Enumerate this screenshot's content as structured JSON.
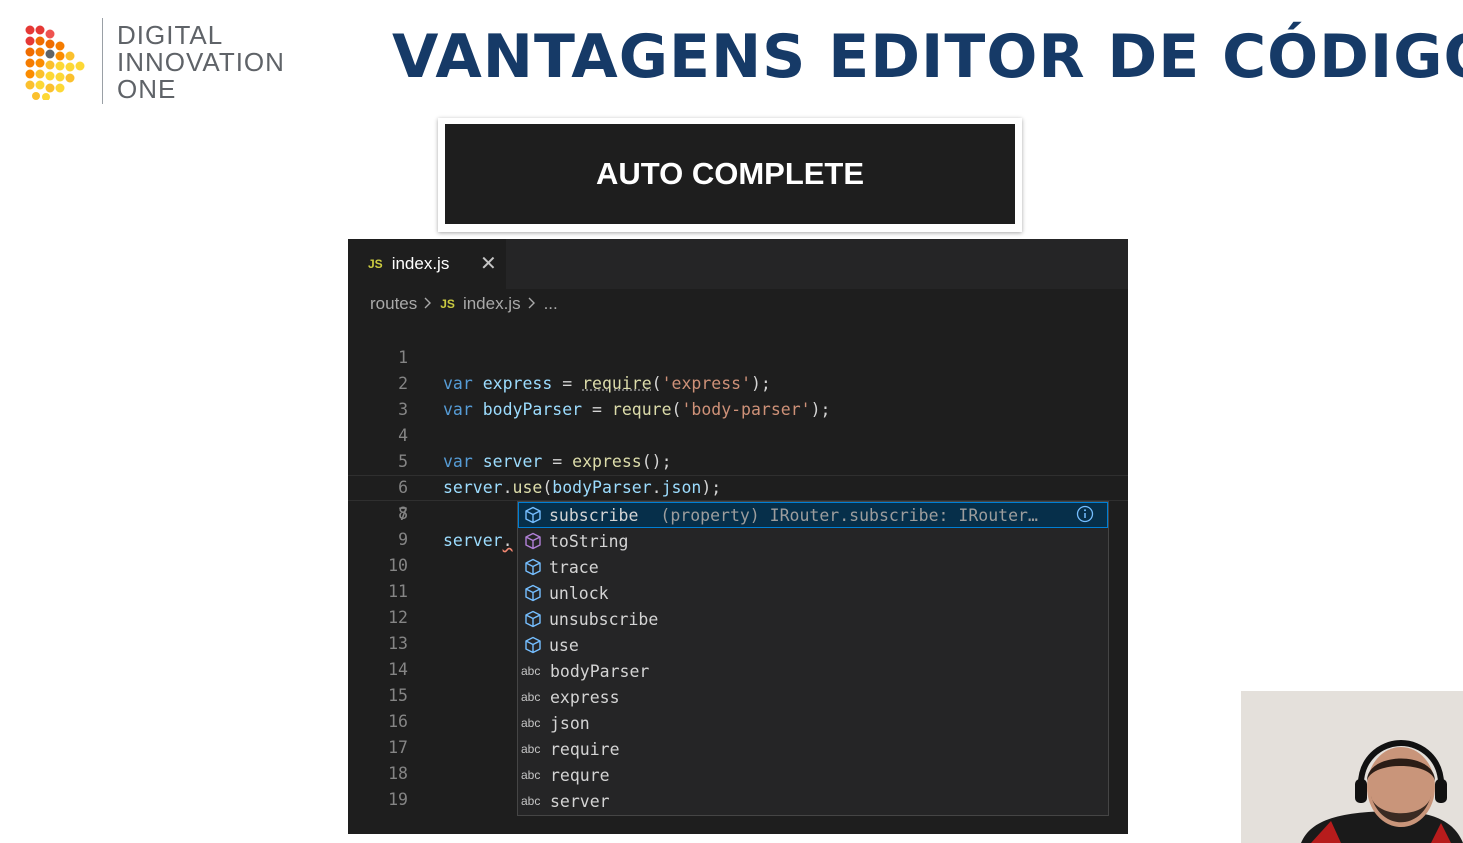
{
  "logo": {
    "lines": [
      "DIGITAL",
      "INNOVATION",
      "ONE"
    ]
  },
  "page_title": "VANTAGENS EDITOR DE CÓDIGO",
  "banner": {
    "label": "AUTO COMPLETE"
  },
  "editor": {
    "tab": {
      "badge": "JS",
      "filename": "index.js",
      "close": "✕"
    },
    "breadcrumb": {
      "folder": "routes",
      "badge": "JS",
      "file": "index.js",
      "more": "..."
    },
    "line_numbers": [
      "1",
      "2",
      "3",
      "4",
      "5",
      "6",
      "7",
      "8",
      "9",
      "10",
      "11",
      "12",
      "13",
      "14",
      "15",
      "16",
      "17",
      "18",
      "19"
    ],
    "code": {
      "l1": {
        "kw": "var",
        "name": "express",
        "op": " = ",
        "fn": "require",
        "p1": "(",
        "str": "'express'",
        "p2": ");"
      },
      "l2": {
        "kw": "var",
        "name": "bodyParser",
        "op": " = ",
        "fn": "requre",
        "p1": "(",
        "str": "'body-parser'",
        "p2": ");"
      },
      "l4": {
        "kw": "var",
        "name": "server",
        "op": " = ",
        "fn": "express",
        "p": "();"
      },
      "l5": {
        "obj": "server",
        "dot": ".",
        "fn": "use",
        "p1": "(",
        "arg": "bodyParser",
        "dot2": ".",
        "prop": "json",
        "p2": ");"
      },
      "l7": {
        "obj": "server",
        "dot": "."
      }
    },
    "suggestions": [
      {
        "label": "subscribe",
        "kind": "property",
        "detail": "(property) IRouter.subscribe: IRouter…"
      },
      {
        "label": "toString",
        "kind": "method"
      },
      {
        "label": "trace",
        "kind": "property"
      },
      {
        "label": "unlock",
        "kind": "property"
      },
      {
        "label": "unsubscribe",
        "kind": "property"
      },
      {
        "label": "use",
        "kind": "property"
      },
      {
        "label": "bodyParser",
        "kind": "text",
        "badge": "abc"
      },
      {
        "label": "express",
        "kind": "text",
        "badge": "abc"
      },
      {
        "label": "json",
        "kind": "text",
        "badge": "abc"
      },
      {
        "label": "require",
        "kind": "text",
        "badge": "abc"
      },
      {
        "label": "requre",
        "kind": "text",
        "badge": "abc"
      },
      {
        "label": "server",
        "kind": "text",
        "badge": "abc"
      }
    ]
  },
  "colors": {
    "title": "#163a67",
    "editor_bg": "#1e1e1e",
    "keyword": "#569cd6",
    "variable": "#9cdcfe",
    "function": "#dcdcaa",
    "string": "#ce9178",
    "selection_border": "#007fd4",
    "icon_property": "#75beff",
    "icon_method": "#b180d7"
  }
}
